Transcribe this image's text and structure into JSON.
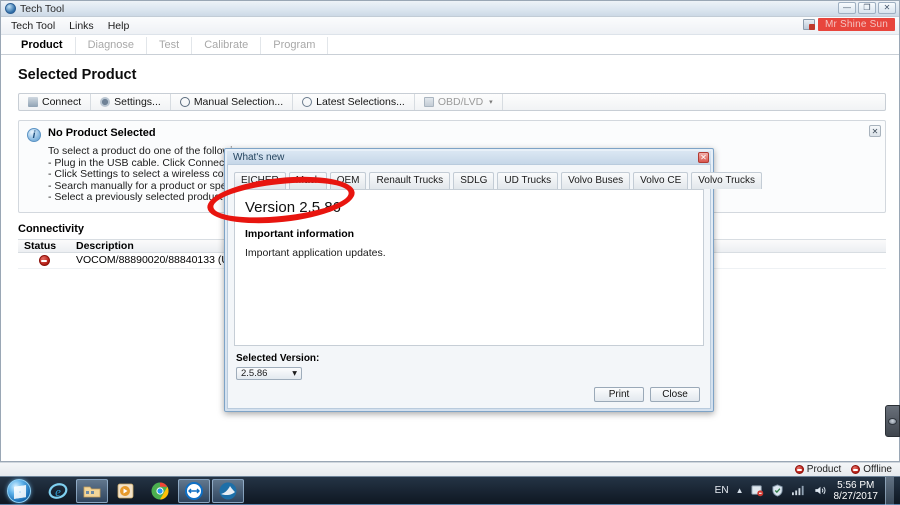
{
  "window": {
    "title": "Tech Tool",
    "app_icon": "volvo-tech-tool-icon",
    "controls": {
      "minimize": "—",
      "maximize": "❐",
      "close": "✕"
    }
  },
  "menubar": {
    "items": [
      {
        "label": "Tech Tool"
      },
      {
        "label": "Links"
      },
      {
        "label": "Help"
      }
    ],
    "user": {
      "name": "Mr Shine Sun",
      "icon": "user-account-icon"
    }
  },
  "ribbon": {
    "tabs": [
      {
        "label": "Product",
        "active": true
      },
      {
        "label": "Diagnose",
        "active": false
      },
      {
        "label": "Test",
        "active": false
      },
      {
        "label": "Calibrate",
        "active": false
      },
      {
        "label": "Program",
        "active": false
      }
    ]
  },
  "page": {
    "title": "Selected Product"
  },
  "toolbar": {
    "buttons": [
      {
        "label": "Connect",
        "icon": "plug-icon",
        "dim": false,
        "caret": false
      },
      {
        "label": "Settings...",
        "icon": "gear-icon",
        "dim": false,
        "caret": false
      },
      {
        "label": "Manual Selection...",
        "icon": "magnifier-icon",
        "dim": false,
        "caret": false
      },
      {
        "label": "Latest Selections...",
        "icon": "clock-icon",
        "dim": false,
        "caret": false
      },
      {
        "label": "OBD/LVD",
        "icon": "obd-icon",
        "dim": true,
        "caret": true
      }
    ]
  },
  "info_panel": {
    "icon": "info-icon",
    "title": "No Product Selected",
    "lines": [
      "To select a product do one of the following:",
      "- Plug in the USB cable. Click Connect if the readout does not start automatically.",
      "- Click Settings to select a wireless communication unit.",
      "- Search manually for a product or specific model in Manual Selection.",
      "- Select a previously selected product in Latest Selections."
    ],
    "close_label": "✕"
  },
  "connectivity": {
    "title": "Connectivity",
    "columns": [
      "Status",
      "Description"
    ],
    "rows": [
      {
        "status_icon": "not-connected-icon",
        "description": "VOCOM/88890020/88840133 (USB) is not connected"
      }
    ]
  },
  "dialog": {
    "title": "What's new",
    "close_label": "✕",
    "tabs": [
      {
        "label": "EICHER"
      },
      {
        "label": "Mack"
      },
      {
        "label": "OEM"
      },
      {
        "label": "Renault Trucks"
      },
      {
        "label": "SDLG"
      },
      {
        "label": "UD Trucks"
      },
      {
        "label": "Volvo Buses"
      },
      {
        "label": "Volvo CE"
      },
      {
        "label": "Volvo Trucks"
      }
    ],
    "content": {
      "version_heading": "Version 2.5.86",
      "section_title": "Important information",
      "section_body": "Important application updates."
    },
    "version_selector": {
      "label": "Selected Version:",
      "value": "2.5.86",
      "caret": "▾"
    },
    "buttons": [
      {
        "label": "Print"
      },
      {
        "label": "Close"
      }
    ]
  },
  "annotation": {
    "type": "red-ellipse-highlight",
    "color": "#e8150f"
  },
  "edge_widget": {
    "icon": "overlay-handle-icon"
  },
  "statusbar": {
    "items": [
      {
        "label": "Product",
        "icon": "status-red-icon"
      },
      {
        "label": "Offline",
        "icon": "status-red-icon"
      }
    ]
  },
  "taskbar": {
    "start": "start-orb-icon",
    "items": [
      {
        "name": "internet-explorer-icon",
        "open": false
      },
      {
        "name": "windows-explorer-icon",
        "open": true
      },
      {
        "name": "media-player-icon",
        "open": false
      },
      {
        "name": "google-chrome-icon",
        "open": false
      },
      {
        "name": "teamviewer-icon",
        "open": true
      },
      {
        "name": "tech-tool-icon",
        "open": true
      }
    ],
    "tray": {
      "language": "EN",
      "arrow": "▲",
      "icons": [
        "action-center-icon",
        "antivirus-icon",
        "network-icon",
        "volume-icon"
      ],
      "time": "5:56 PM",
      "date": "8/27/2017"
    }
  }
}
